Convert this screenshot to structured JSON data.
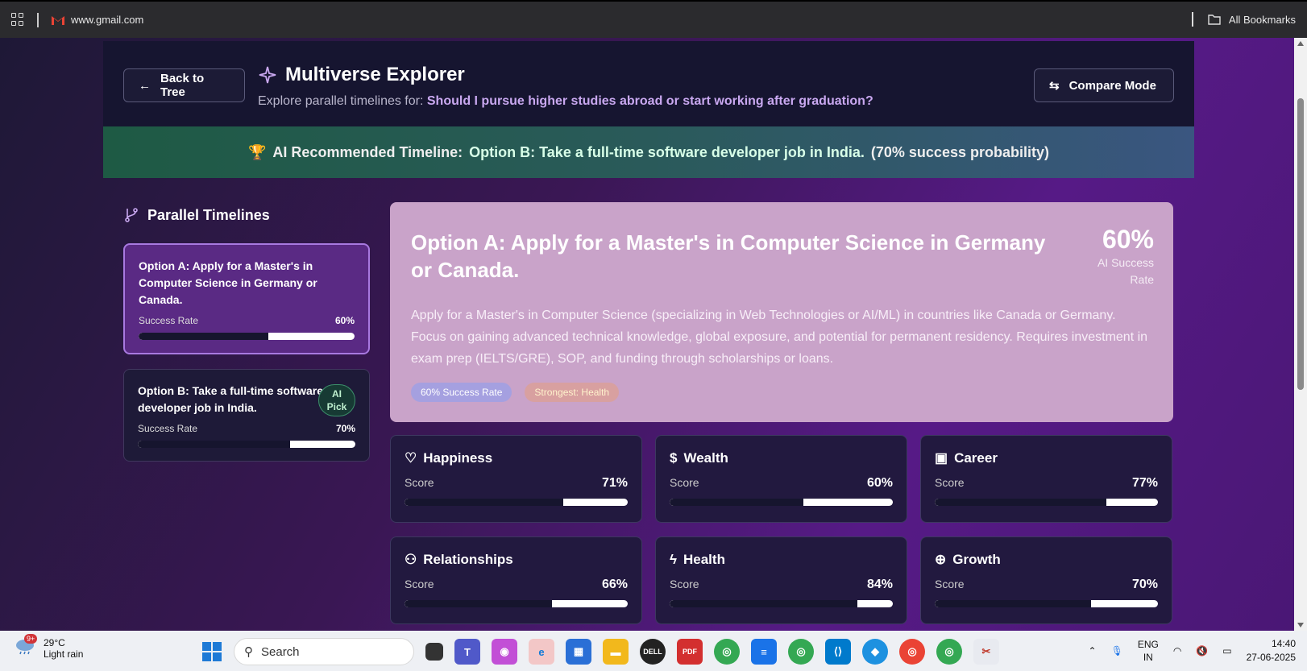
{
  "browser": {
    "url": "www.gmail.com",
    "bookmarks_label": "All Bookmarks"
  },
  "header": {
    "back_label": "Back to Tree",
    "title": "Multiverse Explorer",
    "subtitle_prefix": "Explore parallel timelines for:",
    "question": "Should I pursue higher studies abroad or start working after graduation?",
    "compare_label": "Compare Mode"
  },
  "banner": {
    "prefix": "AI Recommended Timeline:",
    "option": "Option B: Take a full-time software developer job in India.",
    "probability": "(70% success probability)"
  },
  "sidebar": {
    "title": "Parallel Timelines",
    "timelines": [
      {
        "name": "Option A: Apply for a Master's in Computer Science in Germany or Canada.",
        "rate_label": "Success Rate",
        "rate": "60%",
        "value": 0.6,
        "ai_pick": ""
      },
      {
        "name": "Option B: Take a full-time software developer job in India.",
        "rate_label": "Success Rate",
        "rate": "70%",
        "value": 0.7,
        "ai_pick": "AI Pick"
      }
    ]
  },
  "detail": {
    "title": "Option A: Apply for a Master's in Computer Science in Germany or Canada.",
    "rate": "60%",
    "rate_label": "AI Success Rate",
    "description": "Apply for a Master's in Computer Science (specializing in Web Technologies or AI/ML) in countries like Canada or Germany. Focus on gaining advanced technical knowledge, global exposure, and potential for permanent residency. Requires investment in exam prep (IELTS/GRE), SOP, and funding through scholarships or loans.",
    "chip_success": "60% Success Rate",
    "chip_strongest": "Strongest: Health"
  },
  "metrics": [
    {
      "name": "Happiness",
      "icon": "heart-icon",
      "glyph": "♡",
      "score_label": "Score",
      "value": "71%",
      "fraction": 0.71
    },
    {
      "name": "Wealth",
      "icon": "dollar-icon",
      "glyph": "$",
      "score_label": "Score",
      "value": "60%",
      "fraction": 0.6
    },
    {
      "name": "Career",
      "icon": "briefcase-icon",
      "glyph": "▣",
      "score_label": "Score",
      "value": "77%",
      "fraction": 0.77
    },
    {
      "name": "Relationships",
      "icon": "users-icon",
      "glyph": "⚇",
      "score_label": "Score",
      "value": "66%",
      "fraction": 0.66
    },
    {
      "name": "Health",
      "icon": "bolt-icon",
      "glyph": "ϟ",
      "score_label": "Score",
      "value": "84%",
      "fraction": 0.84
    },
    {
      "name": "Growth",
      "icon": "globe-icon",
      "glyph": "⊕",
      "score_label": "Score",
      "value": "70%",
      "fraction": 0.7
    }
  ],
  "taskbar": {
    "weather_temp": "29°C",
    "weather_desc": "Light rain",
    "weather_badge": "9+",
    "search_label": "Search",
    "lang_top": "ENG",
    "lang_bottom": "IN",
    "time": "14:40",
    "date": "27-06-2025"
  },
  "colors": {
    "accent": "#c9a8f0",
    "card_active": "#5a2a84",
    "ai_pick": "#3c8f6a"
  }
}
